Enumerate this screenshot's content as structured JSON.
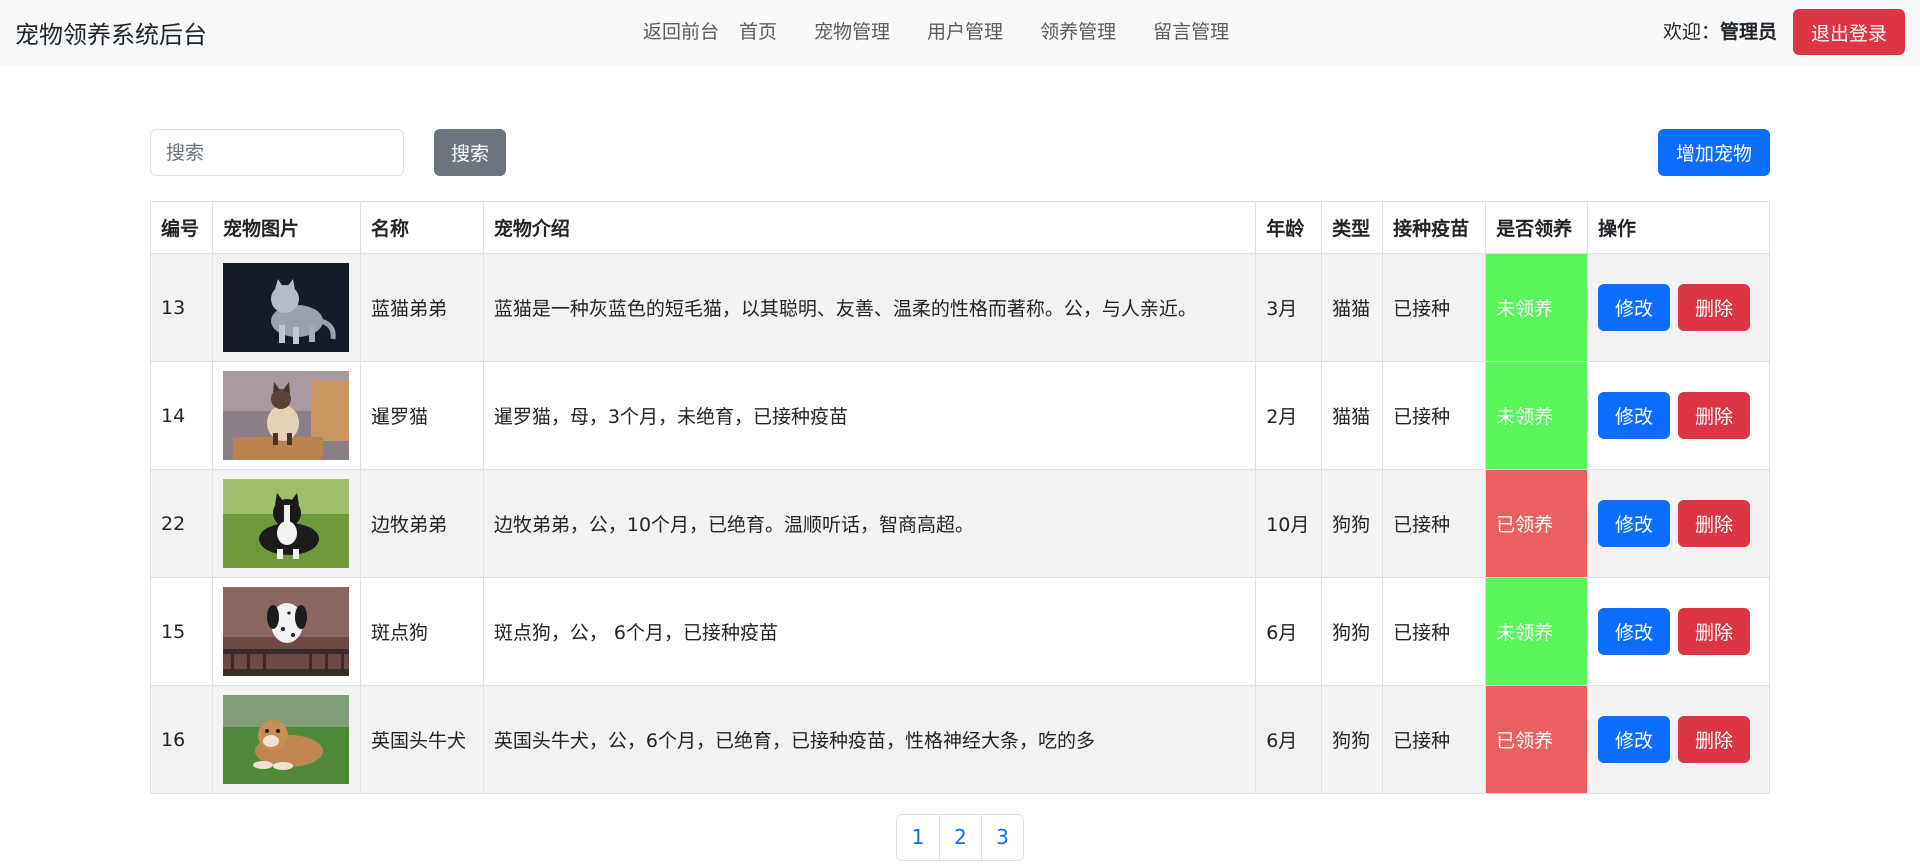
{
  "header": {
    "brand": "宠物领养系统后台",
    "nav": [
      "返回前台",
      "首页",
      "宠物管理",
      "用户管理",
      "领养管理",
      "留言管理"
    ],
    "welcome_prefix": "欢迎：",
    "user": "管理员",
    "logout": "退出登录"
  },
  "toolbar": {
    "search_placeholder": "搜索",
    "search_button": "搜索",
    "add_button": "增加宠物"
  },
  "table": {
    "columns": [
      "编号",
      "宠物图片",
      "名称",
      "宠物介绍",
      "年龄",
      "类型",
      "接种疫苗",
      "是否领养",
      "操作"
    ],
    "edit_label": "修改",
    "delete_label": "删除",
    "rows": [
      {
        "id": "13",
        "name": "蓝猫弟弟",
        "intro": "蓝猫是一种灰蓝色的短毛猫，以其聪明、友善、温柔的性格而著称。公，与人亲近。",
        "age": "3月",
        "type": "猫猫",
        "vaccine": "已接种",
        "adopted": "未领养",
        "image": "gray-cat-photo"
      },
      {
        "id": "14",
        "name": "暹罗猫",
        "intro": "暹罗猫，母，3个月，未绝育，已接种疫苗",
        "age": "2月",
        "type": "猫猫",
        "vaccine": "已接种",
        "adopted": "未领养",
        "image": "siamese-cat-photo"
      },
      {
        "id": "22",
        "name": "边牧弟弟",
        "intro": "边牧弟弟，公，10个月，已绝育。温顺听话，智商高超。",
        "age": "10月",
        "type": "狗狗",
        "vaccine": "已接种",
        "adopted": "已领养",
        "image": "border-collie-photo"
      },
      {
        "id": "15",
        "name": "斑点狗",
        "intro": "斑点狗，公， 6个月，已接种疫苗",
        "age": "6月",
        "type": "狗狗",
        "vaccine": "已接种",
        "adopted": "未领养",
        "image": "dalmatian-photo"
      },
      {
        "id": "16",
        "name": "英国头牛犬",
        "intro": "英国头牛犬，公，6个月，已绝育，已接种疫苗，性格神经大条，吃的多",
        "age": "6月",
        "type": "狗狗",
        "vaccine": "已接种",
        "adopted": "已领养",
        "image": "bulldog-photo"
      }
    ]
  },
  "pagination": [
    "1",
    "2",
    "3"
  ],
  "colors": {
    "primary": "#0d6efd",
    "danger": "#dc3545",
    "secondary": "#6c757d",
    "not_adopted": "#5af55a",
    "adopted": "#ea6060"
  }
}
